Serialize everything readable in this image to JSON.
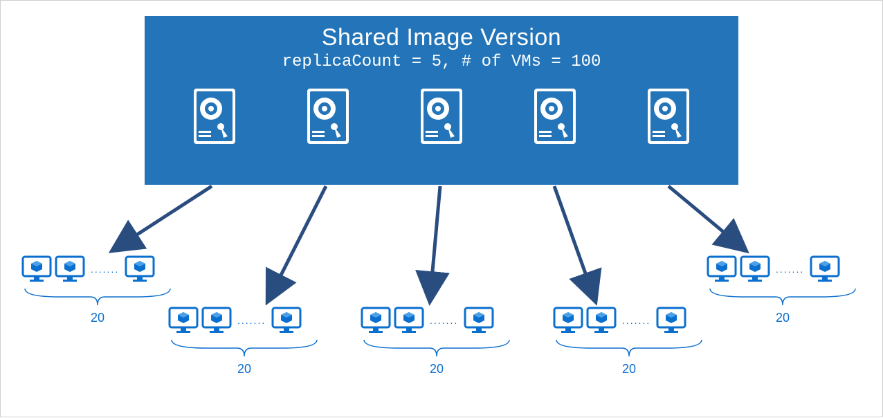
{
  "header": {
    "title": "Shared Image Version",
    "subtitle": "replicaCount = 5, # of VMs = 100"
  },
  "replicas": {
    "count_label": "5",
    "disks": [
      "disk-1",
      "disk-2",
      "disk-3",
      "disk-4",
      "disk-5"
    ]
  },
  "vm_groups": [
    {
      "vms_per_group": "20"
    },
    {
      "vms_per_group": "20"
    },
    {
      "vms_per_group": "20"
    },
    {
      "vms_per_group": "20"
    },
    {
      "vms_per_group": "20"
    }
  ],
  "colors": {
    "box": "#2374b8",
    "accent": "#0a6fce",
    "arrow": "#2a4d80"
  }
}
